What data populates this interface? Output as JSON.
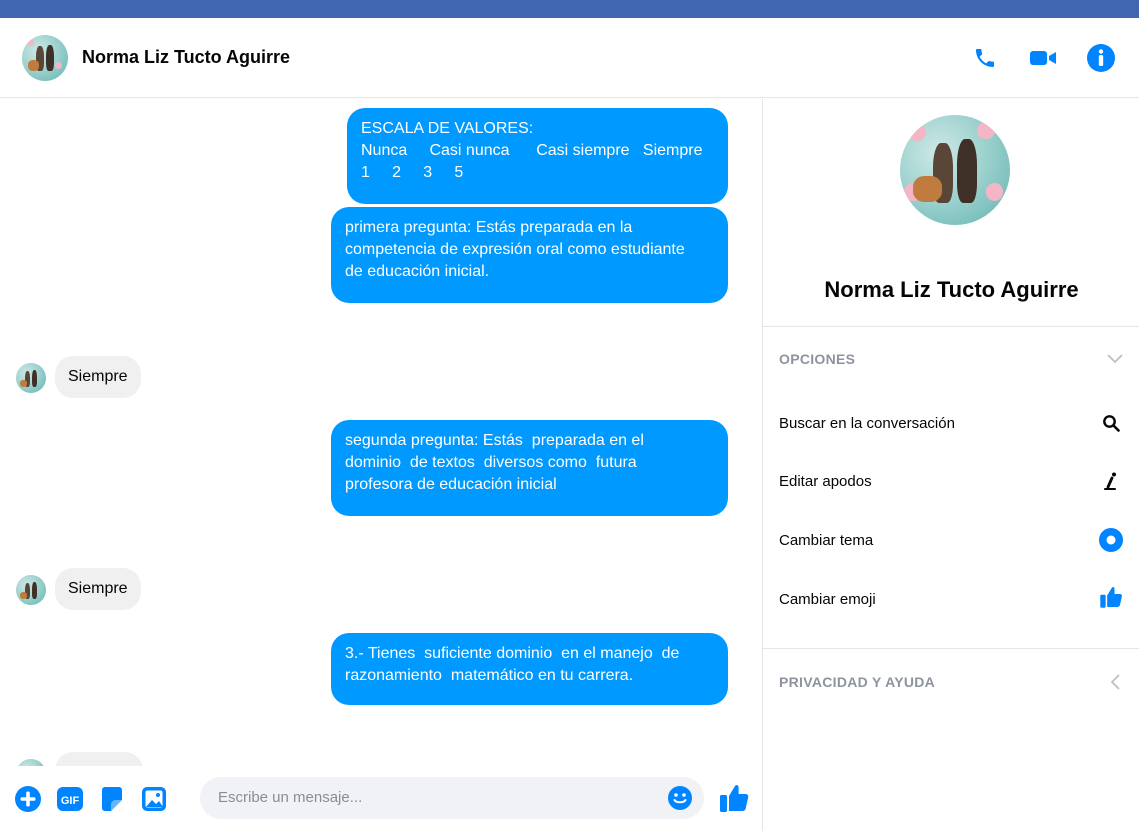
{
  "header": {
    "contact_name": "Norma Liz Tucto Aguirre",
    "actions": [
      "phone-icon",
      "video-camera-icon",
      "info-icon"
    ],
    "accent_color": "#0084ff"
  },
  "messages": [
    {
      "direction": "out",
      "lines": [
        "ESCALA DE VALORES:",
        "Nunca     Casi nunca      Casi siempre   Siempre",
        "1     2     3     5"
      ]
    },
    {
      "direction": "out",
      "lines": [
        "primera pregunta: Estás preparada en la",
        "competencia de expresión oral como estudiante",
        "de educación inicial."
      ]
    },
    {
      "direction": "in",
      "text": "Siempre"
    },
    {
      "direction": "out",
      "lines": [
        "segunda pregunta: Estás  preparada en el",
        "dominio  de textos  diversos como  futura",
        "profesora de educación inicial"
      ]
    },
    {
      "direction": "in",
      "text": "Siempre"
    },
    {
      "direction": "out",
      "lines": [
        "3.- Tienes  suficiente dominio  en el manejo  de",
        "razonamiento  matemático en tu carrera."
      ]
    }
  ],
  "composer": {
    "placeholder": "Escribe un mensaje...",
    "buttons": [
      "plus-icon",
      "gif-icon",
      "sticker-icon",
      "image-icon",
      "emoji-icon",
      "thumbs-up-icon"
    ]
  },
  "sidebar": {
    "name": "Norma Liz Tucto Aguirre",
    "options_title": "OPCIONES",
    "options": [
      {
        "label": "Buscar en la conversación",
        "icon": "search-icon"
      },
      {
        "label": "Editar apodos",
        "icon": "edit-nickname-icon"
      },
      {
        "label": "Cambiar tema",
        "icon": "theme-icon"
      },
      {
        "label": "Cambiar emoji",
        "icon": "thumbs-up-icon"
      }
    ],
    "privacy_title": "PRIVACIDAD Y AYUDA"
  },
  "colors": {
    "bubble_out": "#0099ff",
    "bubble_in": "#f0f0f0",
    "top_bar": "#4267b2"
  }
}
